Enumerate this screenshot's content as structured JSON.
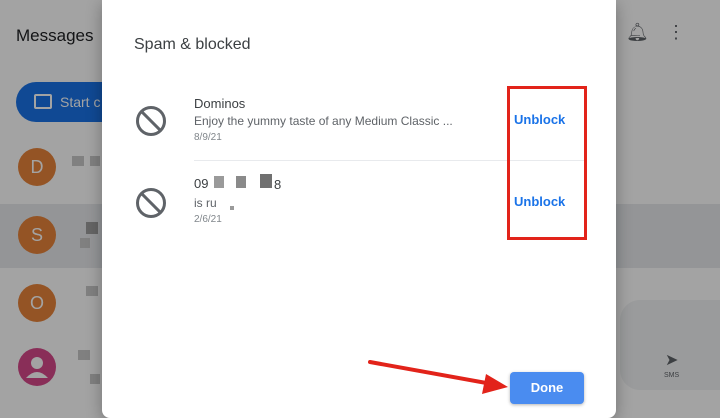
{
  "app": {
    "title": "Messages",
    "start_chat_label": "Start c",
    "compose_sms_label": "SMS",
    "conversations": [
      {
        "initial": "D",
        "color": "#e8843a"
      },
      {
        "initial": "S",
        "color": "#e8843a"
      },
      {
        "initial": "O",
        "color": "#e8843a"
      },
      {
        "initial": "",
        "color": "#d6488a"
      }
    ]
  },
  "dialog": {
    "title": "Spam & blocked",
    "items": [
      {
        "name": "Dominos",
        "snippet": "Enjoy the yummy taste of any Medium Classic ...",
        "date": "8/9/21",
        "action": "Unblock"
      },
      {
        "name": "09",
        "name_tail": "8",
        "snippet": "is ru",
        "date": "2/6/21",
        "action": "Unblock"
      }
    ],
    "done_label": "Done"
  },
  "colors": {
    "accent": "#1a73e8",
    "done_button": "#4a8cf0",
    "highlight": "#e2231a"
  }
}
